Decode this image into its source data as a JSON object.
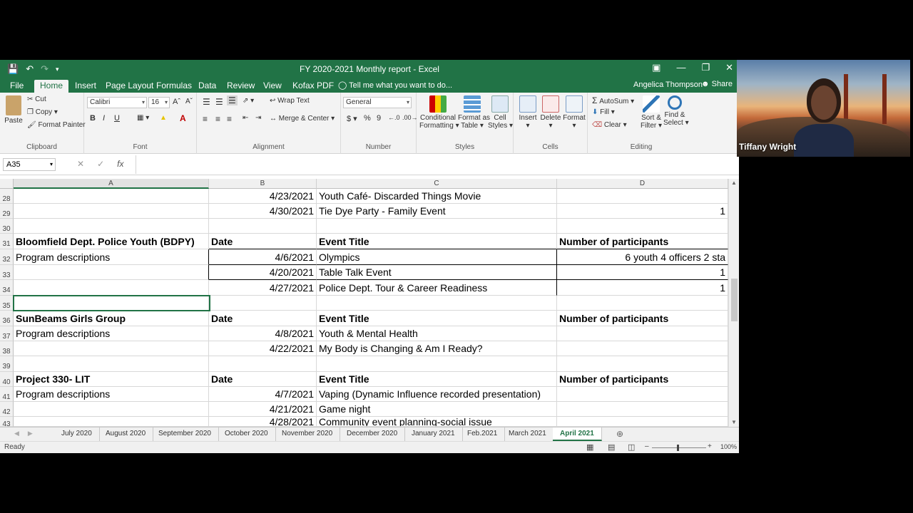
{
  "titlebar": {
    "doc_title": "FY 2020-2021 Monthly report - Excel",
    "save_icon": "save-icon",
    "undo_icon": "undo-icon",
    "redo_icon": "redo-icon"
  },
  "ribbon_tabs": [
    "File",
    "Home",
    "Insert",
    "Page Layout",
    "Formulas",
    "Data",
    "Review",
    "View",
    "Kofax PDF"
  ],
  "active_tab": "Home",
  "tell_me": "Tell me what you want to do...",
  "user_name": "Angelica Thompson",
  "share_label": "Share",
  "clipboard": {
    "paste": "Paste",
    "cut": "Cut",
    "copy": "Copy",
    "format_painter": "Format Painter",
    "label": "Clipboard"
  },
  "font": {
    "name": "Calibri",
    "size": "16",
    "bold": "B",
    "italic": "I",
    "underline": "U",
    "label": "Font"
  },
  "alignment": {
    "wrap_text": "Wrap Text",
    "merge_center": "Merge & Center",
    "label": "Alignment"
  },
  "number": {
    "format": "General",
    "currency": "$",
    "percent": "%",
    "comma": "9",
    "label": "Number"
  },
  "styles": {
    "conditional": "Conditional",
    "conditional2": "Formatting",
    "format_as": "Format as",
    "format_as2": "Table",
    "cell": "Cell",
    "cell2": "Styles",
    "label": "Styles"
  },
  "cells": {
    "insert": "Insert",
    "delete": "Delete",
    "format": "Format",
    "label": "Cells"
  },
  "editing": {
    "autosum": "AutoSum",
    "fill": "Fill",
    "clear": "Clear",
    "sort": "Sort &",
    "sort2": "Filter",
    "find": "Find &",
    "find2": "Select",
    "label": "Editing"
  },
  "formula_bar": {
    "name_box": "A35",
    "fx": "fx",
    "value": ""
  },
  "columns": [
    "A",
    "B",
    "C",
    "D"
  ],
  "rows": [
    {
      "num": "28",
      "a": "",
      "b": "4/23/2021",
      "c": "Youth Café- Discarded Things Movie",
      "d": ""
    },
    {
      "num": "29",
      "a": "",
      "b": "4/30/2021",
      "c": "Tie Dye Party - Family Event",
      "d": "1"
    },
    {
      "num": "30",
      "a": "",
      "b": "",
      "c": "",
      "d": ""
    },
    {
      "num": "31",
      "a": "Bloomfield Dept. Police Youth (BDPY)",
      "b": "Date",
      "c": "Event Title",
      "d": "Number of participants"
    },
    {
      "num": "32",
      "a": "Program descriptions",
      "b": "4/6/2021",
      "c": "Olympics",
      "d": "6 youth 4 officers 2 sta"
    },
    {
      "num": "33",
      "a": "",
      "b": "4/20/2021",
      "c": "Table Talk Event",
      "d": "1"
    },
    {
      "num": "34",
      "a": "",
      "b": "4/27/2021",
      "c": "Police Dept. Tour & Career Readiness",
      "d": "1"
    },
    {
      "num": "35",
      "a": "",
      "b": "",
      "c": "",
      "d": ""
    },
    {
      "num": "36",
      "a": "SunBeams Girls Group",
      "b": "Date",
      "c": "Event Title",
      "d": "Number of participants"
    },
    {
      "num": "37",
      "a": "Program descriptions",
      "b": "4/8/2021",
      "c": "Youth & Mental Health",
      "d": ""
    },
    {
      "num": "38",
      "a": "",
      "b": "4/22/2021",
      "c": "My Body is Changing & Am I Ready?",
      "d": ""
    },
    {
      "num": "39",
      "a": "",
      "b": "",
      "c": "",
      "d": ""
    },
    {
      "num": "40",
      "a": "Project 330- LIT",
      "b": "Date",
      "c": "Event Title",
      "d": "Number of participants"
    },
    {
      "num": "41",
      "a": "Program descriptions",
      "b": "4/7/2021",
      "c": "Vaping (Dynamic Influence recorded presentation)",
      "d": ""
    },
    {
      "num": "42",
      "a": "",
      "b": "4/21/2021",
      "c": "Game night",
      "d": ""
    },
    {
      "num": "43",
      "a": "",
      "b": "4/28/2021",
      "c": "Community event planning-social issue",
      "d": ""
    }
  ],
  "sheets": [
    "July 2020",
    "August 2020",
    "September 2020",
    "October 2020",
    "November 2020",
    "December 2020",
    "January 2021",
    "Feb.2021",
    "March 2021",
    "April 2021"
  ],
  "active_sheet": "April 2021",
  "status": {
    "ready": "Ready",
    "zoom": "100%"
  },
  "webcam": {
    "participant": "Tiffany Wright"
  },
  "colors": {
    "excel_green": "#217346"
  }
}
